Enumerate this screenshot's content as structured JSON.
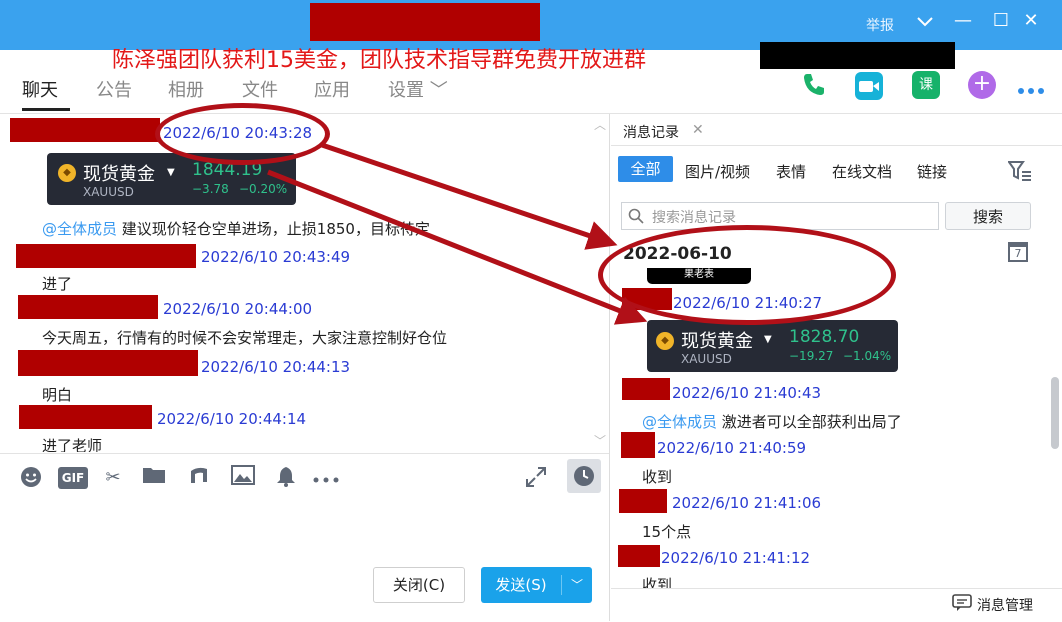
{
  "titlebar": {
    "report_label": "举报",
    "minimize_glyph": "—",
    "maximize_glyph": "☐",
    "close_glyph": "✕"
  },
  "banner_text": "陈泽强团队获利15美金，团队技术指导群免费开放进群",
  "tabs": [
    {
      "label": "聊天",
      "active": true
    },
    {
      "label": "公告"
    },
    {
      "label": "相册"
    },
    {
      "label": "文件"
    },
    {
      "label": "应用"
    },
    {
      "label": "设置 ﹀"
    }
  ],
  "header_icons": {
    "course_label": "课"
  },
  "chat": {
    "messages": [
      {
        "time": "2022/6/10 20:43:28"
      },
      {
        "time": "2022/6/10 20:43:49",
        "text": "进了"
      },
      {
        "time": "2022/6/10 20:44:00",
        "text": "今天周五，行情有的时候不会安常理走，大家注意控制好仓位"
      },
      {
        "time": "2022/6/10 20:44:13",
        "text": "明白"
      },
      {
        "time": "2022/6/10 20:44:14",
        "text": "进了老师"
      }
    ],
    "gold_card": {
      "name": "现货黄金",
      "symbol": "XAUUSD",
      "price": "1844.19",
      "change": "−3.78",
      "change_pct": "−0.20%"
    },
    "mention": "@全体成员",
    "mention_text": "建议现价轻仓空单进场，止损1850，目标待定"
  },
  "toolbar": {
    "gif_label": "GIF",
    "close_button": "关闭(C)",
    "send_button": "发送(S)"
  },
  "history_panel": {
    "title": "消息记录",
    "filter_tabs": [
      "全部",
      "图片/视频",
      "表情",
      "在线文档",
      "链接"
    ],
    "search_placeholder": "搜索消息记录",
    "search_button": "搜索",
    "date_heading": "2022-06-10",
    "calendar_day": "7",
    "tooltip": "果老表",
    "gold_card": {
      "name": "现货黄金",
      "symbol": "XAUUSD",
      "price": "1828.70",
      "change": "−19.27",
      "change_pct": "−1.04%"
    },
    "messages": [
      {
        "time": "2022/6/10 21:40:27"
      },
      {
        "time": "2022/6/10 21:40:43",
        "mention": "@全体成员",
        "text": "激进者可以全部获利出局了"
      },
      {
        "time": "2022/6/10 21:40:59",
        "text": "收到"
      },
      {
        "time": "2022/6/10 21:41:06",
        "text": "15个点"
      },
      {
        "time": "2022/6/10 21:41:12",
        "text": "收到"
      }
    ],
    "manage_label": "消息管理"
  },
  "colors": {
    "titlebar": "#3aa2ee",
    "annotation_red": "#b11018",
    "timestamp_blue": "#2a3bd3",
    "price_green": "#2fc18c",
    "send_blue": "#1aa2ea"
  }
}
